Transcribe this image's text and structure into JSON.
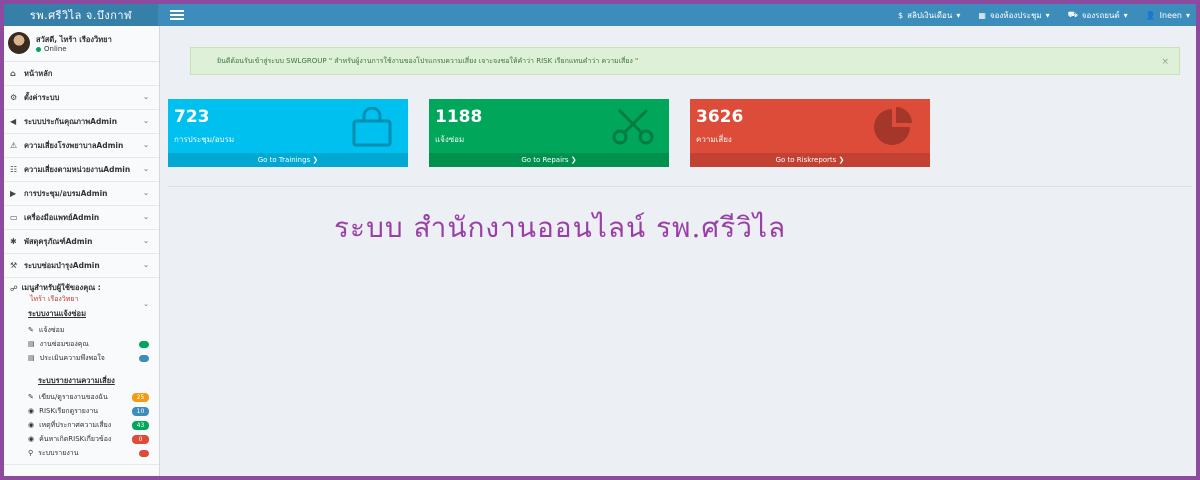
{
  "app": {
    "title": "รพ.ศรีวิไล จ.บึงกาฬ"
  },
  "topnav": [
    {
      "icon": "dollar-icon",
      "label": "สลิปเงินเดือน"
    },
    {
      "icon": "calendar-icon",
      "label": "จองห้องประชุม"
    },
    {
      "icon": "car-icon",
      "label": "จองรถยนต์"
    },
    {
      "icon": "user-icon",
      "label": "Ineen"
    }
  ],
  "user": {
    "name": "สวัสดี, ไทร้า เรืองวิทยา",
    "status": "Online"
  },
  "sidebar": {
    "items": [
      {
        "icon": "home-icon",
        "label": "หน้าหลัก",
        "chevron": false
      },
      {
        "icon": "gear-icon",
        "label": "ตั้งค่าระบบ",
        "chevron": true
      },
      {
        "icon": "megaphone-icon",
        "label": "ระบบประกันคุณภาพAdmin",
        "chevron": true
      },
      {
        "icon": "warning-icon",
        "label": "ความเสี่ยงโรงพยาบาลAdmin",
        "chevron": true
      },
      {
        "icon": "report-icon",
        "label": "ความเสี่ยงตามหน่วยงานAdmin",
        "chevron": true
      },
      {
        "icon": "meeting-icon",
        "label": "การประชุม/อบรมAdmin",
        "chevron": true
      },
      {
        "icon": "laptop-icon",
        "label": "เครื่องมือแพทย์Admin",
        "chevron": true
      },
      {
        "icon": "wrench-icon",
        "label": "พัสดุครุภัณฑ์Admin",
        "chevron": true
      },
      {
        "icon": "tools-icon",
        "label": "ระบบซ่อมบำรุงAdmin",
        "chevron": true
      }
    ],
    "section": {
      "head": "เมนูสำหรับผู้ใช้ของคุณ :",
      "note": "ไทร้า เรืองวิทยา",
      "repair_title": "ระบบงานแจ้งซ่อม",
      "repair_rows": [
        {
          "icon": "pencil-icon",
          "label": "แจ้งซ่อม",
          "pill_color": "#ffffff"
        },
        {
          "icon": "list-icon",
          "label": "งานซ่อมของคุณ",
          "pill_color": "#00a65a"
        },
        {
          "icon": "list-icon",
          "label": "ประเมินความพึงพอใจ",
          "pill_color": "#3c8dbc"
        }
      ],
      "risk_title": "ระบบรายงานความเสี่ยง",
      "risk_rows": [
        {
          "icon": "pencil-icon",
          "label": "เขียน/ดูรายงานของฉัน",
          "badge": "25",
          "badge_color": "#f39c12"
        },
        {
          "icon": "eye-icon",
          "label": "RISKเรียกดูรายงาน",
          "badge": "10",
          "badge_color": "#3c8dbc"
        },
        {
          "icon": "eye-icon",
          "label": "เหตุที่ประกาศความเสี่ยง",
          "badge": "43",
          "badge_color": "#00a65a"
        },
        {
          "icon": "eye-icon",
          "label": "ค้นหาเกิดRISKเกี่ยวข้อง",
          "badge": "0",
          "badge_color": "#dd4b39"
        },
        {
          "icon": "search-icon",
          "label": "ระบบรายงาน",
          "badge": "",
          "badge_color": "#dd4b39"
        }
      ]
    }
  },
  "alert": {
    "text": "ยินดีต้อนรับเข้าสู่ระบบ SWLGROUP \" สำหรับผู้งานการใช้งานของโปรแกรมความเสี่ยง เจาะจงชอให้คำว่า RISK เรียกแทนคำว่า ความเสี่ยง \"",
    "close": "×"
  },
  "boxes": [
    {
      "value": "723",
      "label": "การประชุม/อบรม",
      "link": "Go to Trainings ❯",
      "icon": "shopping-bag-icon",
      "color": "#00c0ef"
    },
    {
      "value": "1188",
      "label": "แจ้งซ่อม",
      "link": "Go to Repairs ❯",
      "icon": "scissors-icon",
      "color": "#00a65a"
    },
    {
      "value": "3626",
      "label": "ความเสี่ยง",
      "link": "Go to Riskreports ❯",
      "icon": "pie-chart-icon",
      "color": "#dd4b39"
    }
  ],
  "headline": "ระบบ สำนักงานออนไลน์ รพ.ศรีวิไล"
}
